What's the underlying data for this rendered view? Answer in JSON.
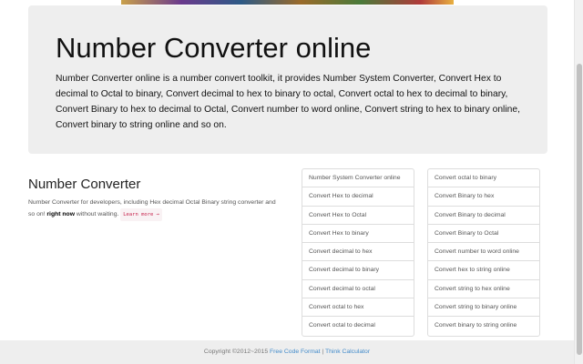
{
  "hero": {
    "title": "Number Converter online",
    "description": "Number Converter online is a number convert toolkit, it provides Number System Converter, Convert Hex to decimal to Octal to binary, Convert decimal to hex to binary to octal, Convert octal to hex to decimal to binary, Convert Binary to hex to decimal to Octal, Convert number to word online, Convert string to hex to binary online, Convert binary to string online and so on."
  },
  "intro": {
    "heading": "Number Converter",
    "text_before": "Number Converter for developers, including Hex decimal Octal Binary string converter and so on! ",
    "bold": "right now",
    "text_after": " without waiting.",
    "learn_more": "Learn more →"
  },
  "links_left": [
    "Number System Converter online",
    "Convert Hex to decimal",
    "Convert Hex to Octal",
    "Convert Hex to binary",
    "Convert decimal to hex",
    "Convert decimal to binary",
    "Convert decimal to octal",
    "Convert octal to hex",
    "Convert octal to decimal"
  ],
  "links_right": [
    "Convert octal to binary",
    "Convert Binary to hex",
    "Convert Binary to decimal",
    "Convert Binary to Octal",
    "Convert number to word online",
    "Convert hex to string online",
    "Convert string to hex online",
    "Convert string to binary online",
    "Convert binary to string online"
  ],
  "footer": {
    "copyright": "Copyright ©2012~2015 ",
    "link1": "Free Code Format",
    "separator": " | ",
    "link2": "Think Calculator"
  }
}
